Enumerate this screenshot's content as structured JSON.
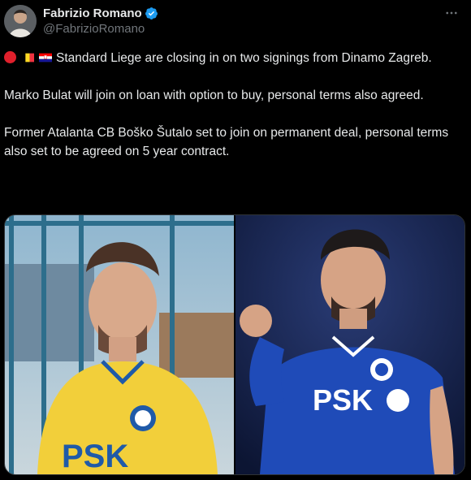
{
  "author": {
    "display_name": "Fabrizio Romano",
    "handle": "@FabrizioRomano",
    "verified": true
  },
  "more_icon": "ellipsis-icon",
  "tweet": {
    "flags": [
      "red-circle",
      "belgium-flag",
      "croatia-flag"
    ],
    "paragraphs": [
      "Standard Liege are closing in on two signings from Dinamo Zagreb.",
      "Marko Bulat will join on loan with option to buy, personal terms also agreed.",
      "Former Atalanta CB Boško Šutalo set to join on permanent deal, personal terms also set to be agreed on 5 year contract."
    ]
  },
  "media": {
    "photos": [
      {
        "description_icon": "player-photo-yellow-kit",
        "sponsor": "PSK"
      },
      {
        "description_icon": "player-photo-blue-kit",
        "sponsor": "PSK"
      }
    ]
  },
  "colors": {
    "background": "#000000",
    "text": "#e7e9ea",
    "muted": "#71767b",
    "verified": "#1d9bf0"
  }
}
